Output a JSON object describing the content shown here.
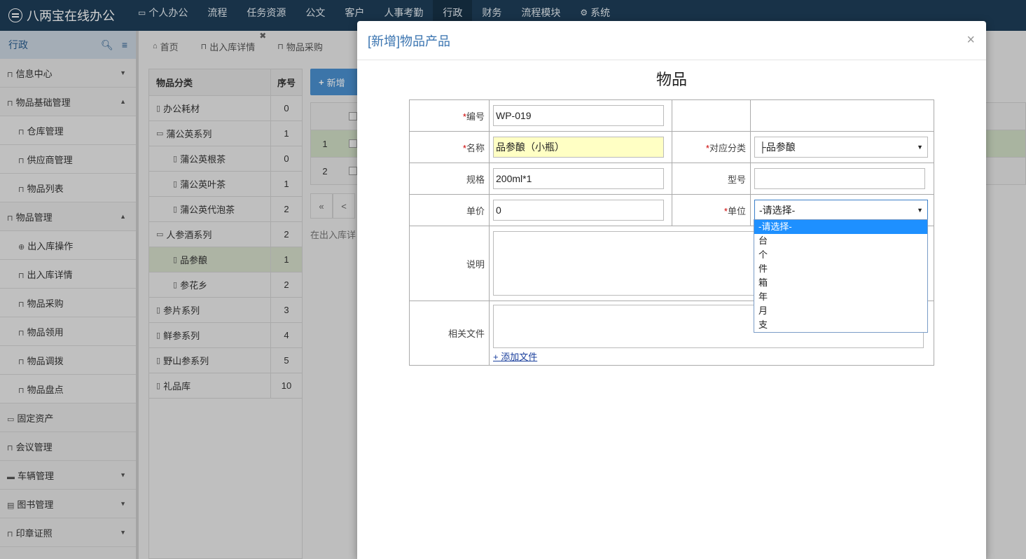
{
  "app": {
    "title": "八两宝在线办公"
  },
  "nav": [
    {
      "label": "个人办公",
      "icon": "monitor-icon"
    },
    {
      "label": "流程"
    },
    {
      "label": "任务资源"
    },
    {
      "label": "公文"
    },
    {
      "label": "客户"
    },
    {
      "label": "人事考勤"
    },
    {
      "label": "行政",
      "active": true
    },
    {
      "label": "财务"
    },
    {
      "label": "流程模块"
    },
    {
      "label": "系统",
      "icon": "gear-icon"
    }
  ],
  "sidebar": {
    "title": "行政",
    "items": [
      {
        "label": "信息中心",
        "level": 0,
        "caret": "down"
      },
      {
        "label": "物品基础管理",
        "level": 0,
        "caret": "up"
      },
      {
        "label": "仓库管理",
        "level": 1
      },
      {
        "label": "供应商管理",
        "level": 1
      },
      {
        "label": "物品列表",
        "level": 1
      },
      {
        "label": "物品管理",
        "level": 0,
        "caret": "up"
      },
      {
        "label": "出入库操作",
        "level": 1,
        "icon": "plus-circle-icon"
      },
      {
        "label": "出入库详情",
        "level": 1
      },
      {
        "label": "物品采购",
        "level": 1
      },
      {
        "label": "物品领用",
        "level": 1
      },
      {
        "label": "物品调拨",
        "level": 1
      },
      {
        "label": "物品盘点",
        "level": 1
      },
      {
        "label": "固定资产",
        "level": 0,
        "icon": "laptop-icon"
      },
      {
        "label": "会议管理",
        "level": 0
      },
      {
        "label": "车辆管理",
        "level": 0,
        "icon": "truck-icon",
        "caret": "down"
      },
      {
        "label": "图书管理",
        "level": 0,
        "icon": "book-icon",
        "caret": "down"
      },
      {
        "label": "印章证照",
        "level": 0,
        "caret": "down"
      }
    ]
  },
  "tabs": [
    {
      "label": "首页",
      "icon": "home-icon"
    },
    {
      "label": "出入库详情",
      "closable": true
    },
    {
      "label": "物品采购"
    }
  ],
  "category": {
    "header_name": "物品分类",
    "header_seq": "序号",
    "rows": [
      {
        "name": "办公耗材",
        "seq": "0",
        "type": "file",
        "level": 0
      },
      {
        "name": "蒲公英系列",
        "seq": "1",
        "type": "folder",
        "level": 0
      },
      {
        "name": "蒲公英根茶",
        "seq": "0",
        "type": "file",
        "level": 1
      },
      {
        "name": "蒲公英叶茶",
        "seq": "1",
        "type": "file",
        "level": 1
      },
      {
        "name": "蒲公英代泡茶",
        "seq": "2",
        "type": "file",
        "level": 1
      },
      {
        "name": "人参酒系列",
        "seq": "2",
        "type": "folder",
        "level": 0
      },
      {
        "name": "品参酿",
        "seq": "1",
        "type": "file",
        "level": 1,
        "selected": true
      },
      {
        "name": "参花乡",
        "seq": "2",
        "type": "file",
        "level": 1
      },
      {
        "name": "参片系列",
        "seq": "3",
        "type": "file",
        "level": 0
      },
      {
        "name": "鲜参系列",
        "seq": "4",
        "type": "file",
        "level": 0
      },
      {
        "name": "野山参系列",
        "seq": "5",
        "type": "file",
        "level": 0
      },
      {
        "name": "礼品库",
        "seq": "10",
        "type": "file",
        "level": 0
      }
    ]
  },
  "list": {
    "add_label": "新增",
    "rows": [
      "1",
      "2"
    ],
    "pager_first": "«",
    "pager_prev": "<",
    "hint": "在出入库详"
  },
  "modal": {
    "title": "[新增]物品产品",
    "close": "×",
    "form_title": "物品",
    "fields": {
      "code_label": "编号",
      "code_value": "WP-019",
      "name_label": "名称",
      "name_value": "品参酿（小瓶）",
      "category_label": "对应分类",
      "category_value": "├品参酿",
      "spec_label": "规格",
      "spec_value": "200ml*1",
      "model_label": "型号",
      "model_value": "",
      "price_label": "单价",
      "price_value": "0",
      "unit_label": "单位",
      "unit_value": "-请选择-",
      "desc_label": "说明",
      "files_label": "相关文件",
      "add_file_link": "+ 添加文件"
    },
    "unit_options": [
      "-请选择-",
      "台",
      "个",
      "件",
      "箱",
      "年",
      "月",
      "支"
    ],
    "unit_highlighted": 0
  }
}
